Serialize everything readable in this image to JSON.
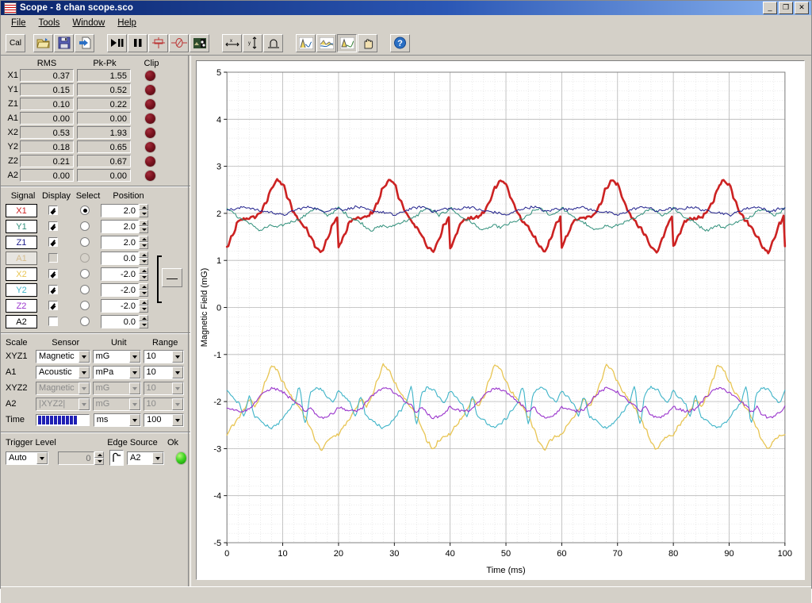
{
  "window": {
    "title": "Scope - 8 chan scope.sco",
    "icon": "scope-waves-icon",
    "buttons": [
      {
        "name": "minimize-button",
        "glyph": "_"
      },
      {
        "name": "restore-button",
        "glyph": "❐"
      },
      {
        "name": "close-button",
        "glyph": "✕"
      }
    ]
  },
  "menu": [
    {
      "name": "menu-file",
      "label": "File",
      "accel": "F"
    },
    {
      "name": "menu-tools",
      "label": "Tools",
      "accel": "T"
    },
    {
      "name": "menu-window",
      "label": "Window",
      "accel": "W"
    },
    {
      "name": "menu-help",
      "label": "Help",
      "accel": "H"
    }
  ],
  "toolbar": {
    "cal_label": "Cal",
    "buttons": [
      {
        "name": "calibrate-button",
        "icon": "cal-text",
        "pressed": false
      },
      {
        "name": "open-file-button",
        "icon": "open-folder-icon",
        "pressed": false
      },
      {
        "name": "save-file-button",
        "icon": "floppy-disk-icon",
        "pressed": false
      },
      {
        "name": "export-button",
        "icon": "export-arrow-icon",
        "pressed": false
      },
      {
        "name": "run-button",
        "icon": "play-pause-icon",
        "pressed": false
      },
      {
        "name": "pause-button",
        "icon": "pause-icon",
        "pressed": false
      },
      {
        "name": "trigger-level-button",
        "icon": "trigger-level-icon",
        "pressed": false
      },
      {
        "name": "zero-button",
        "icon": "zero-offset-icon",
        "pressed": false
      },
      {
        "name": "snapshot-button",
        "icon": "snapshot-icon",
        "pressed": false
      },
      {
        "name": "cursor-x-button",
        "icon": "horizontal-cursor-icon",
        "pressed": false
      },
      {
        "name": "cursor-y-button",
        "icon": "vertical-cursor-icon",
        "pressed": false
      },
      {
        "name": "magnet-button",
        "icon": "magnet-icon",
        "pressed": false
      },
      {
        "name": "peak-view-button",
        "icon": "peak-waveform-icon",
        "pressed": false
      },
      {
        "name": "spectrum-view-button",
        "icon": "spectrum-waveform-icon",
        "pressed": false
      },
      {
        "name": "zoom-region-button",
        "icon": "zoom-waveform-icon",
        "pressed": true
      },
      {
        "name": "pan-button",
        "icon": "hand-pan-icon",
        "pressed": false
      },
      {
        "name": "help-button",
        "icon": "help-question-icon",
        "pressed": false
      }
    ]
  },
  "meters": {
    "headers": [
      "RMS",
      "Pk-Pk",
      "Clip"
    ],
    "rows": [
      {
        "channel": "X1",
        "rms": "0.37",
        "pkpk": "1.55",
        "clip": false
      },
      {
        "channel": "Y1",
        "rms": "0.15",
        "pkpk": "0.52",
        "clip": false
      },
      {
        "channel": "Z1",
        "rms": "0.10",
        "pkpk": "0.22",
        "clip": false
      },
      {
        "channel": "A1",
        "rms": "0.00",
        "pkpk": "0.00",
        "clip": false
      },
      {
        "channel": "X2",
        "rms": "0.53",
        "pkpk": "1.93",
        "clip": false
      },
      {
        "channel": "Y2",
        "rms": "0.18",
        "pkpk": "0.65",
        "clip": false
      },
      {
        "channel": "Z2",
        "rms": "0.21",
        "pkpk": "0.67",
        "clip": false
      },
      {
        "channel": "A2",
        "rms": "0.00",
        "pkpk": "0.00",
        "clip": false
      }
    ]
  },
  "signals": {
    "headers": [
      "Signal",
      "Display",
      "Select",
      "Position"
    ],
    "group_button_label": "—",
    "rows": [
      {
        "name": "X1",
        "color": "#cc2222",
        "display": true,
        "select": true,
        "position": "2.0",
        "enabled": true
      },
      {
        "name": "Y1",
        "color": "#2f8f7a",
        "display": true,
        "select": false,
        "position": "2.0",
        "enabled": true
      },
      {
        "name": "Z1",
        "color": "#20208c",
        "display": true,
        "select": false,
        "position": "2.0",
        "enabled": true
      },
      {
        "name": "A1",
        "color": "#d9a441",
        "display": false,
        "select": false,
        "position": "0.0",
        "enabled": false
      },
      {
        "name": "X2",
        "color": "#e8c553",
        "display": true,
        "select": false,
        "position": "-2.0",
        "enabled": true
      },
      {
        "name": "Y2",
        "color": "#3fb4c8",
        "display": true,
        "select": false,
        "position": "-2.0",
        "enabled": true
      },
      {
        "name": "Z2",
        "color": "#9933cc",
        "display": true,
        "select": false,
        "position": "-2.0",
        "enabled": true
      },
      {
        "name": "A2",
        "color": "#000000",
        "display": false,
        "select": false,
        "position": "0.0",
        "enabled": true
      }
    ]
  },
  "scale": {
    "headers": [
      "Scale",
      "Sensor",
      "Unit",
      "Range"
    ],
    "rows": [
      {
        "label": "XYZ1",
        "sensor": "Magnetic",
        "unit": "mG",
        "range": "10",
        "enabled": true
      },
      {
        "label": "A1",
        "sensor": "Acoustic",
        "unit": "mPa",
        "range": "10",
        "enabled": true
      },
      {
        "label": "XYZ2",
        "sensor": "Magnetic",
        "unit": "mG",
        "range": "10",
        "enabled": false
      },
      {
        "label": "A2",
        "sensor": "|XYZ2|",
        "unit": "mG",
        "range": "10",
        "enabled": false
      }
    ],
    "time_label": "Time",
    "time_unit": "ms",
    "time_range": "100",
    "time_bar_segments": 10
  },
  "trigger": {
    "headers": [
      "Trigger Level",
      "Edge Source",
      "Ok"
    ],
    "mode": "Auto",
    "level": "0",
    "edge_icon": "rising-edge-icon",
    "source": "A2",
    "status_ok": true
  },
  "chart_data": {
    "type": "line",
    "title": "",
    "xlabel": "Time (ms)",
    "ylabel": "Magnetic Field (mG)",
    "xlim": [
      0,
      100
    ],
    "ylim": [
      -5,
      5
    ],
    "xticks": [
      0,
      10,
      20,
      30,
      40,
      50,
      60,
      70,
      80,
      90,
      100
    ],
    "yticks": [
      -5,
      -4,
      -3,
      -2,
      -1,
      0,
      1,
      2,
      3,
      4,
      5
    ],
    "grid": true,
    "minor_grid": true,
    "minor_step": 0.2,
    "legend": "none",
    "period_ms": 20,
    "series": [
      {
        "name": "X1",
        "color": "#cc2222",
        "width": 2.6,
        "offset": 2.0,
        "x": [
          0,
          1,
          2,
          3,
          4,
          5,
          6,
          7,
          8,
          9,
          10,
          11,
          12,
          13,
          14,
          15,
          16,
          17,
          18,
          19,
          20
        ],
        "y": [
          -0.72,
          -0.48,
          -0.18,
          -0.12,
          -0.1,
          -0.08,
          0.02,
          0.22,
          0.55,
          0.7,
          0.62,
          0.3,
          0.02,
          -0.16,
          -0.3,
          -0.48,
          -0.72,
          -0.82,
          -0.55,
          -0.22,
          -0.05
        ]
      },
      {
        "name": "Y1",
        "color": "#2f8f7a",
        "width": 1.0,
        "offset": 2.0,
        "x": [
          0,
          1,
          2,
          3,
          4,
          5,
          6,
          7,
          8,
          9,
          10,
          11,
          12,
          13,
          14,
          15,
          16,
          17,
          18,
          19,
          20
        ],
        "y": [
          0.12,
          0.02,
          -0.08,
          -0.14,
          -0.2,
          -0.3,
          -0.36,
          -0.3,
          -0.26,
          -0.3,
          -0.25,
          -0.2,
          -0.16,
          -0.12,
          -0.05,
          0.06,
          0.1,
          0.04,
          -0.04,
          0.02,
          0.1
        ]
      },
      {
        "name": "Z1",
        "color": "#20208c",
        "width": 1.0,
        "offset": 2.0,
        "x": [
          0,
          1,
          2,
          3,
          4,
          5,
          6,
          7,
          8,
          9,
          10,
          11,
          12,
          13,
          14,
          15,
          16,
          17,
          18,
          19,
          20
        ],
        "y": [
          0.1,
          0.08,
          0.1,
          0.14,
          0.12,
          0.08,
          0.05,
          0.04,
          0.02,
          0.0,
          -0.04,
          0.0,
          0.06,
          0.1,
          0.12,
          0.14,
          0.1,
          0.04,
          0.06,
          0.1,
          0.1
        ]
      },
      {
        "name": "X2",
        "color": "#e8c553",
        "width": 1.3,
        "offset": -2.0,
        "x": [
          0,
          1,
          2,
          3,
          4,
          5,
          6,
          7,
          8,
          9,
          10,
          11,
          12,
          13,
          14,
          15,
          16,
          17,
          18,
          19,
          20
        ],
        "y": [
          -0.7,
          -0.52,
          -0.36,
          -0.18,
          0.05,
          -0.1,
          0.1,
          0.45,
          0.78,
          0.68,
          0.42,
          0.2,
          0.05,
          -0.12,
          -0.32,
          -0.58,
          -0.86,
          -1.02,
          -0.82,
          -0.74,
          -0.7
        ]
      },
      {
        "name": "Y2",
        "color": "#3fb4c8",
        "width": 1.1,
        "offset": -2.0,
        "x": [
          0,
          1,
          2,
          3,
          4,
          5,
          6,
          7,
          8,
          9,
          10,
          11,
          12,
          13,
          14,
          15,
          16,
          17,
          18,
          19,
          20
        ],
        "y": [
          0.22,
          0.1,
          -0.02,
          -0.3,
          0.1,
          -0.32,
          -0.4,
          -0.5,
          -0.56,
          -0.48,
          -0.36,
          -0.2,
          -0.05,
          0.3,
          -0.46,
          0.18,
          0.3,
          0.26,
          0.1,
          -0.02,
          0.22
        ]
      },
      {
        "name": "Z2",
        "color": "#9933cc",
        "width": 1.1,
        "offset": -2.0,
        "x": [
          0,
          1,
          2,
          3,
          4,
          5,
          6,
          7,
          8,
          9,
          10,
          11,
          12,
          13,
          14,
          15,
          16,
          17,
          18,
          19,
          20
        ],
        "y": [
          -0.12,
          -0.16,
          -0.2,
          -0.2,
          -0.16,
          -0.02,
          0.12,
          0.22,
          0.28,
          0.26,
          0.2,
          0.1,
          0.0,
          -0.08,
          -0.22,
          -0.12,
          -0.28,
          -0.34,
          -0.32,
          -0.24,
          -0.12
        ]
      }
    ]
  },
  "statusbar": {
    "text": ""
  }
}
